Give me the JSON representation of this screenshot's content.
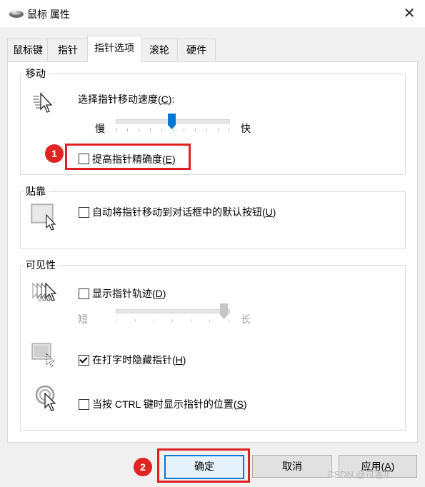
{
  "window": {
    "title": "鼠标 属性",
    "close_glyph": "✕"
  },
  "tabs": [
    {
      "label": "鼠标键"
    },
    {
      "label": "指针"
    },
    {
      "label": "指针选项",
      "active": true
    },
    {
      "label": "滚轮"
    },
    {
      "label": "硬件"
    }
  ],
  "motion": {
    "group_label": "移动",
    "speed_label_pre": "选择指针移动速度(",
    "speed_label_key": "C",
    "speed_label_post": "):",
    "slow": "慢",
    "fast": "快",
    "speed_value_fraction": 0.5,
    "precision_pre": "提高指针精确度(",
    "precision_key": "E",
    "precision_post": ")",
    "precision_checked": false
  },
  "snap": {
    "group_label": "贴靠",
    "snap_pre": "自动将指针移动到对话框中的默认按钮(",
    "snap_key": "U",
    "snap_post": ")",
    "snap_checked": false
  },
  "visibility": {
    "group_label": "可见性",
    "trails_pre": "显示指针轨迹(",
    "trails_key": "D",
    "trails_post": ")",
    "trails_checked": false,
    "short": "短",
    "long": "长",
    "trail_length_fraction": 1.0,
    "hide_pre": "在打字时隐藏指针(",
    "hide_key": "H",
    "hide_post": ")",
    "hide_checked": true,
    "ctrl_pre": "当按 CTRL 键时显示指针的位置(",
    "ctrl_key": "S",
    "ctrl_post": ")",
    "ctrl_checked": false
  },
  "buttons": {
    "ok": "确定",
    "cancel": "取消",
    "apply_pre": "应用(",
    "apply_key": "A",
    "apply_post": ")"
  },
  "annotations": {
    "badge1": "1",
    "badge2": "2"
  },
  "watermark": "CSDN @过客II",
  "colors": {
    "highlight_red": "#e02020",
    "badge_red": "#e02424",
    "accent_blue": "#0078d7"
  }
}
